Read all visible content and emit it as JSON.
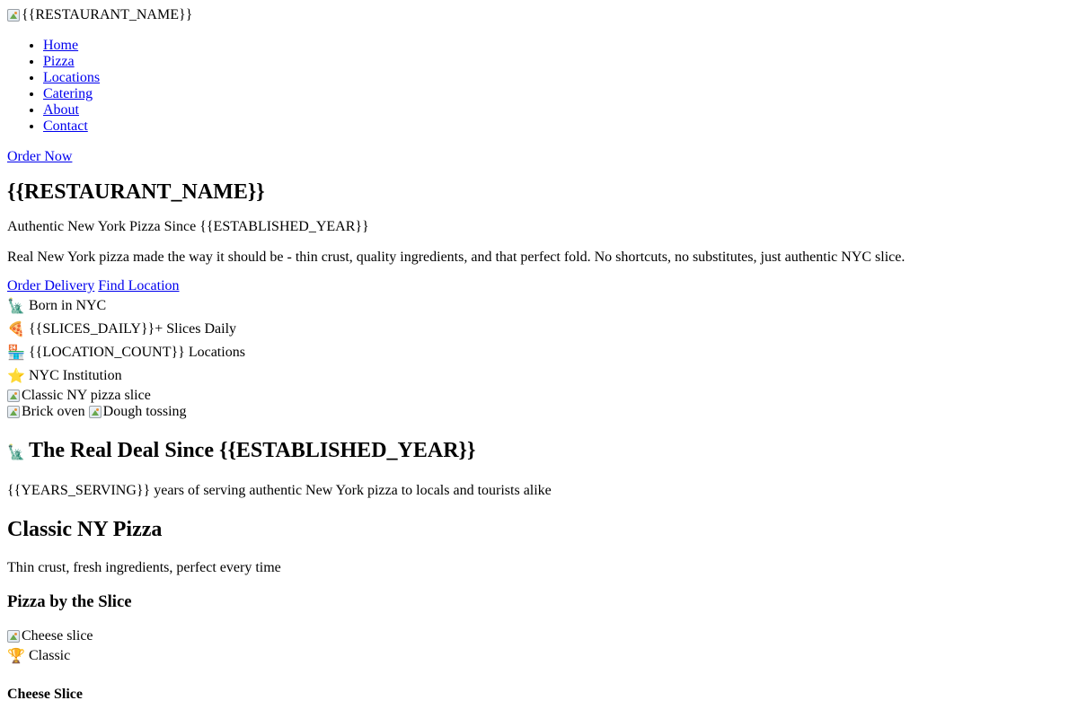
{
  "header": {
    "logo_alt": "{{RESTAURANT_NAME}}",
    "nav": [
      {
        "label": "Home"
      },
      {
        "label": "Pizza"
      },
      {
        "label": "Locations"
      },
      {
        "label": "Catering"
      },
      {
        "label": "About"
      },
      {
        "label": "Contact"
      }
    ],
    "order_now": "Order Now"
  },
  "hero": {
    "title": "{{RESTAURANT_NAME}}",
    "tagline": "Authentic New York Pizza Since {{ESTABLISHED_YEAR}}",
    "description": "Real New York pizza made the way it should be - thin crust, quality ingredients, and that perfect fold. No shortcuts, no substitutes, just authentic NYC slice.",
    "primary_cta": "Order Delivery",
    "secondary_cta": "Find Location",
    "stats": [
      {
        "icon": "🗽",
        "icon_name": "statue-of-liberty-icon",
        "text": "Born in NYC"
      },
      {
        "icon": "🍕",
        "icon_name": "pizza-icon",
        "text": "{{SLICES_DAILY}}+ Slices Daily"
      },
      {
        "icon": "🏪",
        "icon_name": "store-icon",
        "text": "{{LOCATION_COUNT}} Locations"
      },
      {
        "icon": "⭐",
        "icon_name": "star-icon",
        "text": "NYC Institution"
      }
    ],
    "main_image_alt": "Classic NY pizza slice",
    "secondary_images": [
      {
        "alt": "Brick oven"
      },
      {
        "alt": "Dough tossing"
      }
    ]
  },
  "heritage": {
    "icon": "🗽",
    "title": "The Real Deal Since {{ESTABLISHED_YEAR}}",
    "subtitle": "{{YEARS_SERVING}} years of serving authentic New York pizza to locals and tourists alike"
  },
  "menu": {
    "title": "Classic NY Pizza",
    "subtitle": "Thin crust, fresh ingredients, perfect every time",
    "category_title": "Pizza by the Slice",
    "items": [
      {
        "image_alt": "Cheese slice",
        "badge_icon": "🏆",
        "badge_text": "Classic",
        "name": "Cheese Slice"
      }
    ]
  }
}
